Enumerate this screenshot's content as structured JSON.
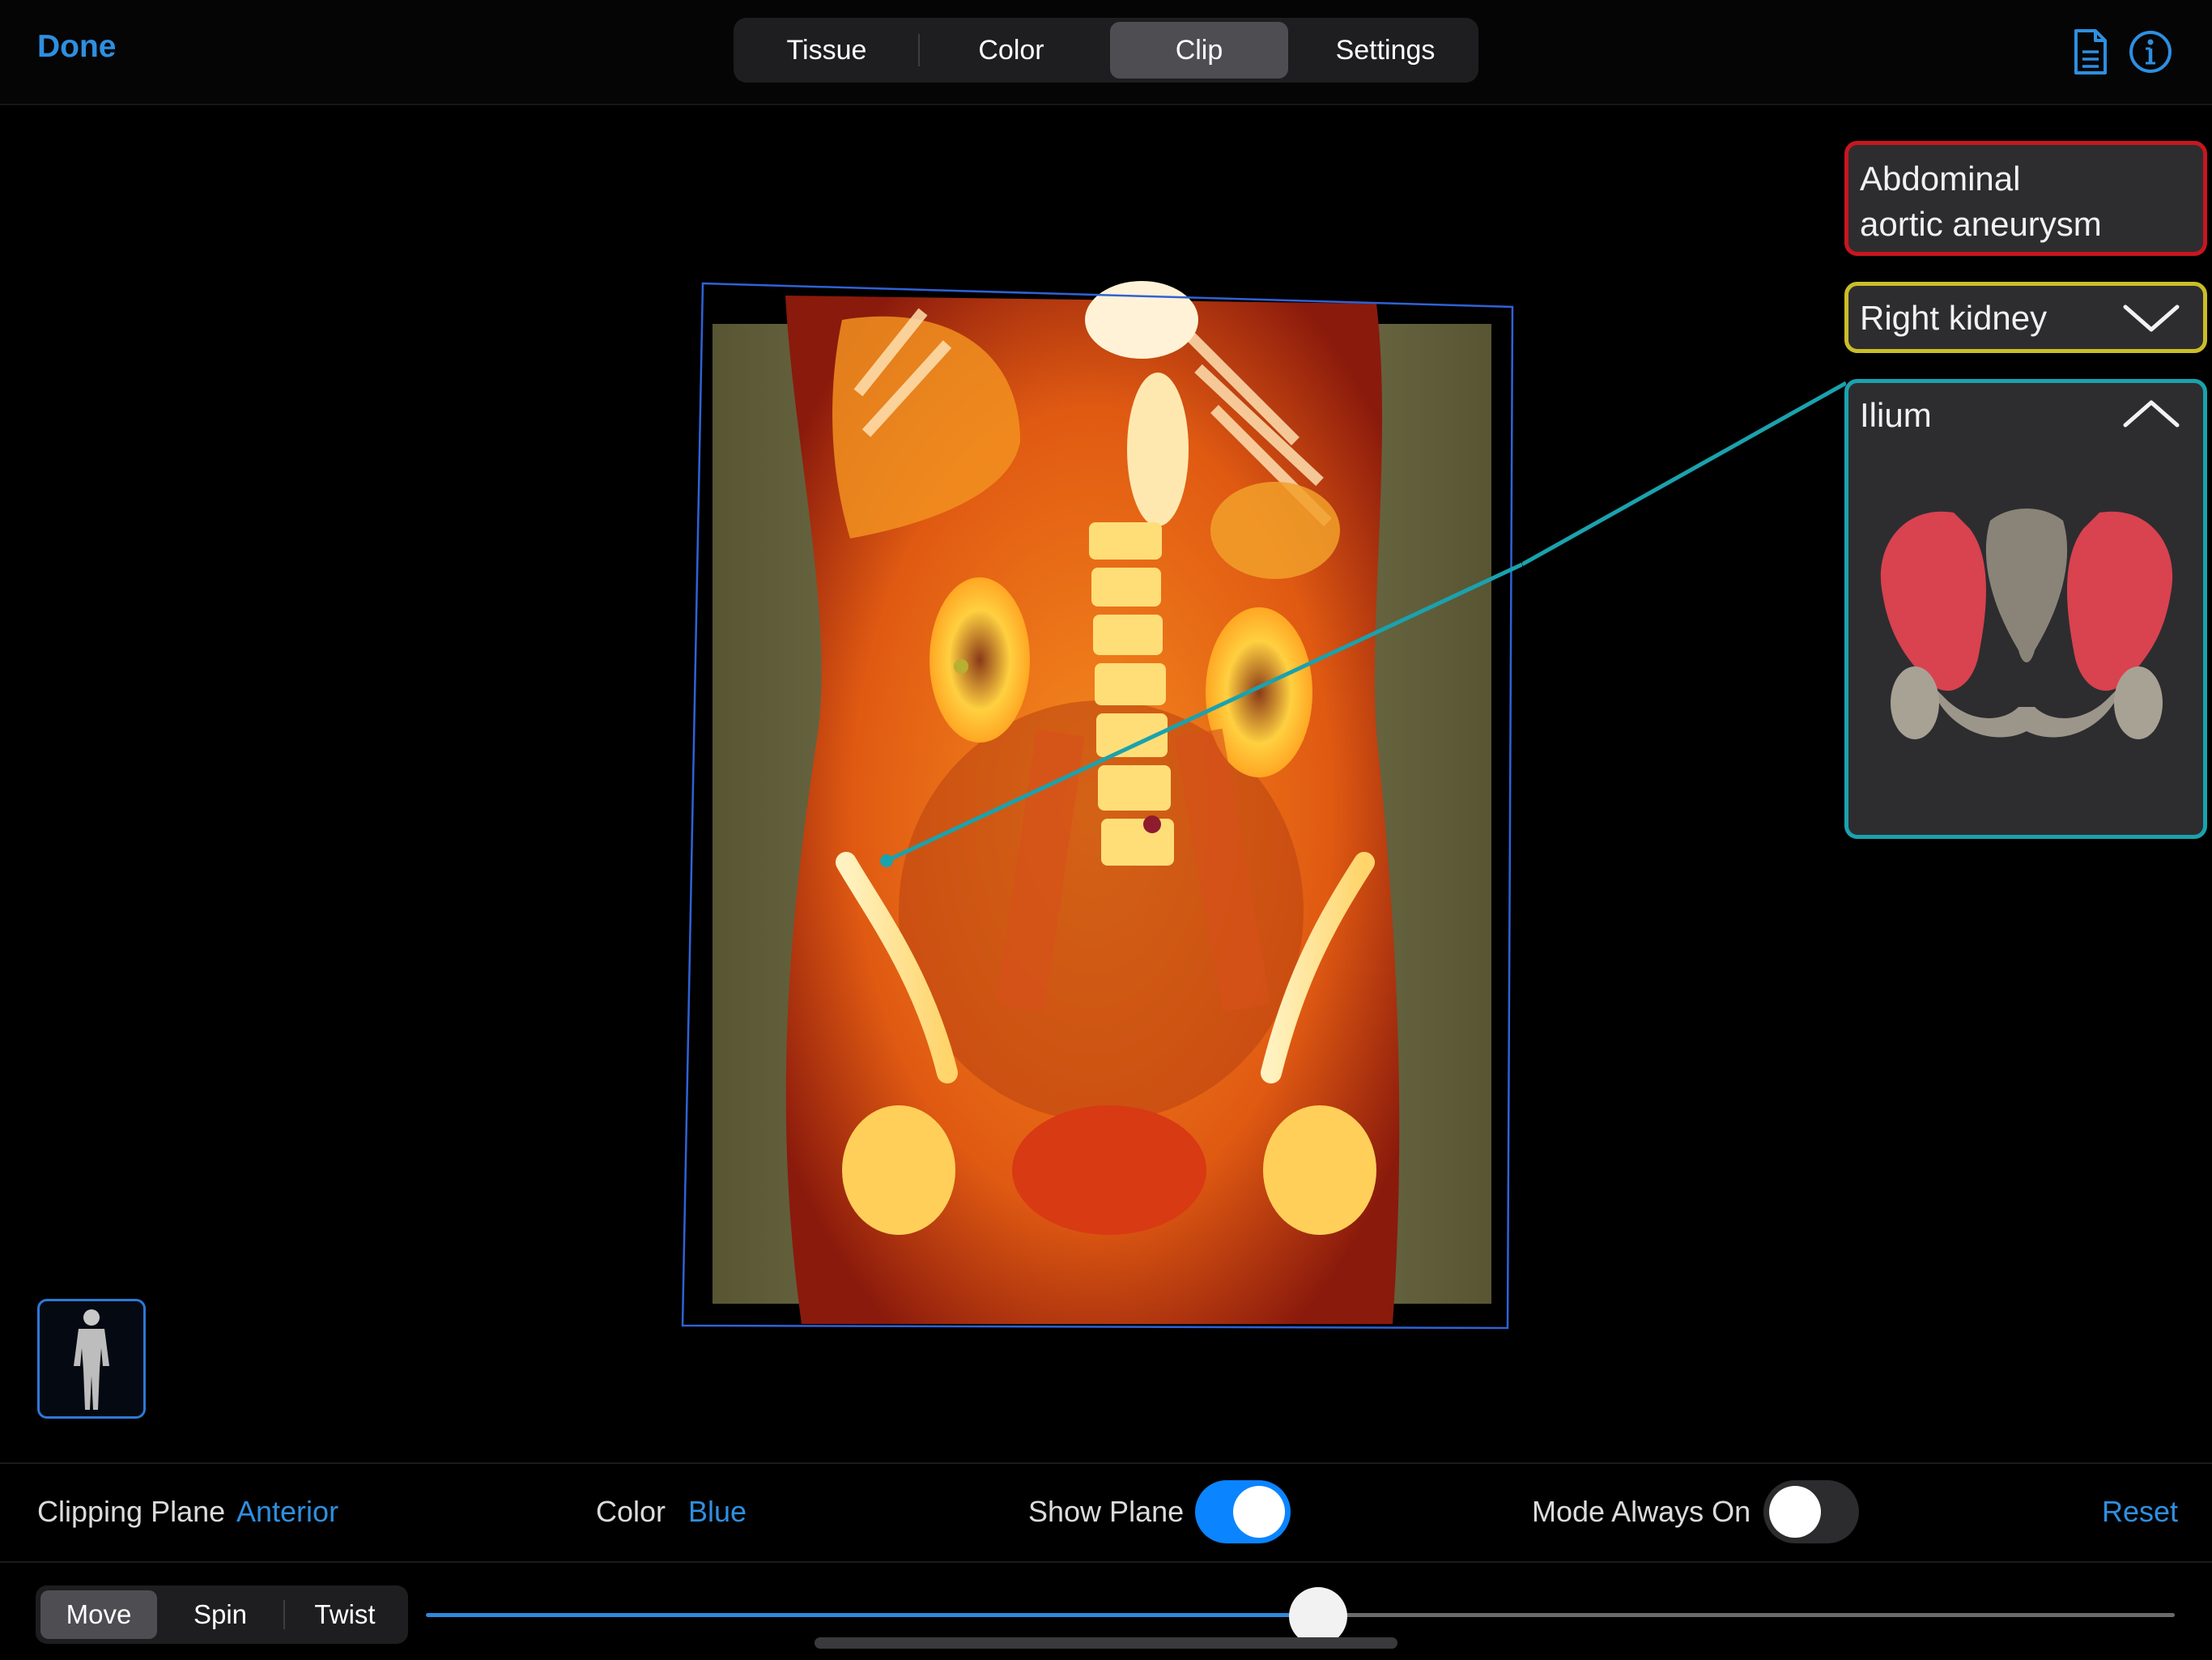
{
  "header": {
    "done_label": "Done",
    "tabs": [
      {
        "label": "Tissue",
        "active": false
      },
      {
        "label": "Color",
        "active": false
      },
      {
        "label": "Clip",
        "active": true
      },
      {
        "label": "Settings",
        "active": false
      }
    ],
    "icons": [
      "document-icon",
      "info-icon"
    ]
  },
  "labels": {
    "aorta": {
      "line1": "Abdominal",
      "line2": "aortic aneurysm",
      "color": "#c8161f"
    },
    "kidney": {
      "text": "Right kidney",
      "color": "#cbbd28",
      "state": "collapsed"
    },
    "ilium": {
      "text": "Ilium",
      "color": "#1aa2ae",
      "state": "expanded"
    }
  },
  "bottom": {
    "clipping_plane_label": "Clipping Plane",
    "clipping_plane_value": "Anterior",
    "color_label": "Color",
    "color_value": "Blue",
    "show_plane_label": "Show Plane",
    "show_plane_on": true,
    "mode_always_on_label": "Mode Always On",
    "mode_always_on_on": false,
    "reset_label": "Reset",
    "modes": [
      {
        "label": "Move",
        "active": true
      },
      {
        "label": "Spin",
        "active": false
      },
      {
        "label": "Twist",
        "active": false
      }
    ],
    "slider_value": 0.51
  },
  "colors": {
    "accent": "#2e8fe0",
    "toggle_on": "#0a84ff",
    "toggle_off": "#3a3a3c"
  }
}
